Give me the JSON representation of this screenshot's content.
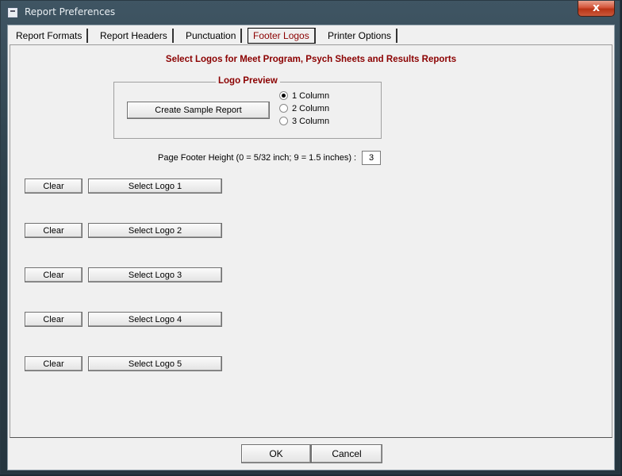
{
  "window": {
    "title": "Report Preferences",
    "close_glyph": "x"
  },
  "tabs": [
    {
      "label": "Report Formats",
      "active": false
    },
    {
      "label": "Report Headers",
      "active": false
    },
    {
      "label": "Punctuation",
      "active": false
    },
    {
      "label": "Footer Logos",
      "active": true
    },
    {
      "label": "Printer Options",
      "active": false
    }
  ],
  "footer_logos": {
    "heading": "Select Logos for Meet Program, Psych Sheets and Results Reports",
    "logo_preview": {
      "legend": "Logo Preview",
      "create_sample_label": "Create Sample Report",
      "columns": [
        {
          "label": "1 Column",
          "checked": true
        },
        {
          "label": "2 Column",
          "checked": false
        },
        {
          "label": "3 Column",
          "checked": false
        }
      ]
    },
    "page_footer_height": {
      "label": "Page Footer Height (0 = 5/32 inch; 9 = 1.5 inches) :",
      "value": "3"
    },
    "logos": [
      {
        "clear_label": "Clear",
        "select_label": "Select Logo 1"
      },
      {
        "clear_label": "Clear",
        "select_label": "Select Logo 2"
      },
      {
        "clear_label": "Clear",
        "select_label": "Select Logo 3"
      },
      {
        "clear_label": "Clear",
        "select_label": "Select Logo 4"
      },
      {
        "clear_label": "Clear",
        "select_label": "Select Logo 5"
      }
    ]
  },
  "buttons": {
    "ok_label": "OK",
    "cancel_label": "Cancel"
  },
  "colors": {
    "accent_text": "#8b0000",
    "close_button": "#c9583b"
  }
}
